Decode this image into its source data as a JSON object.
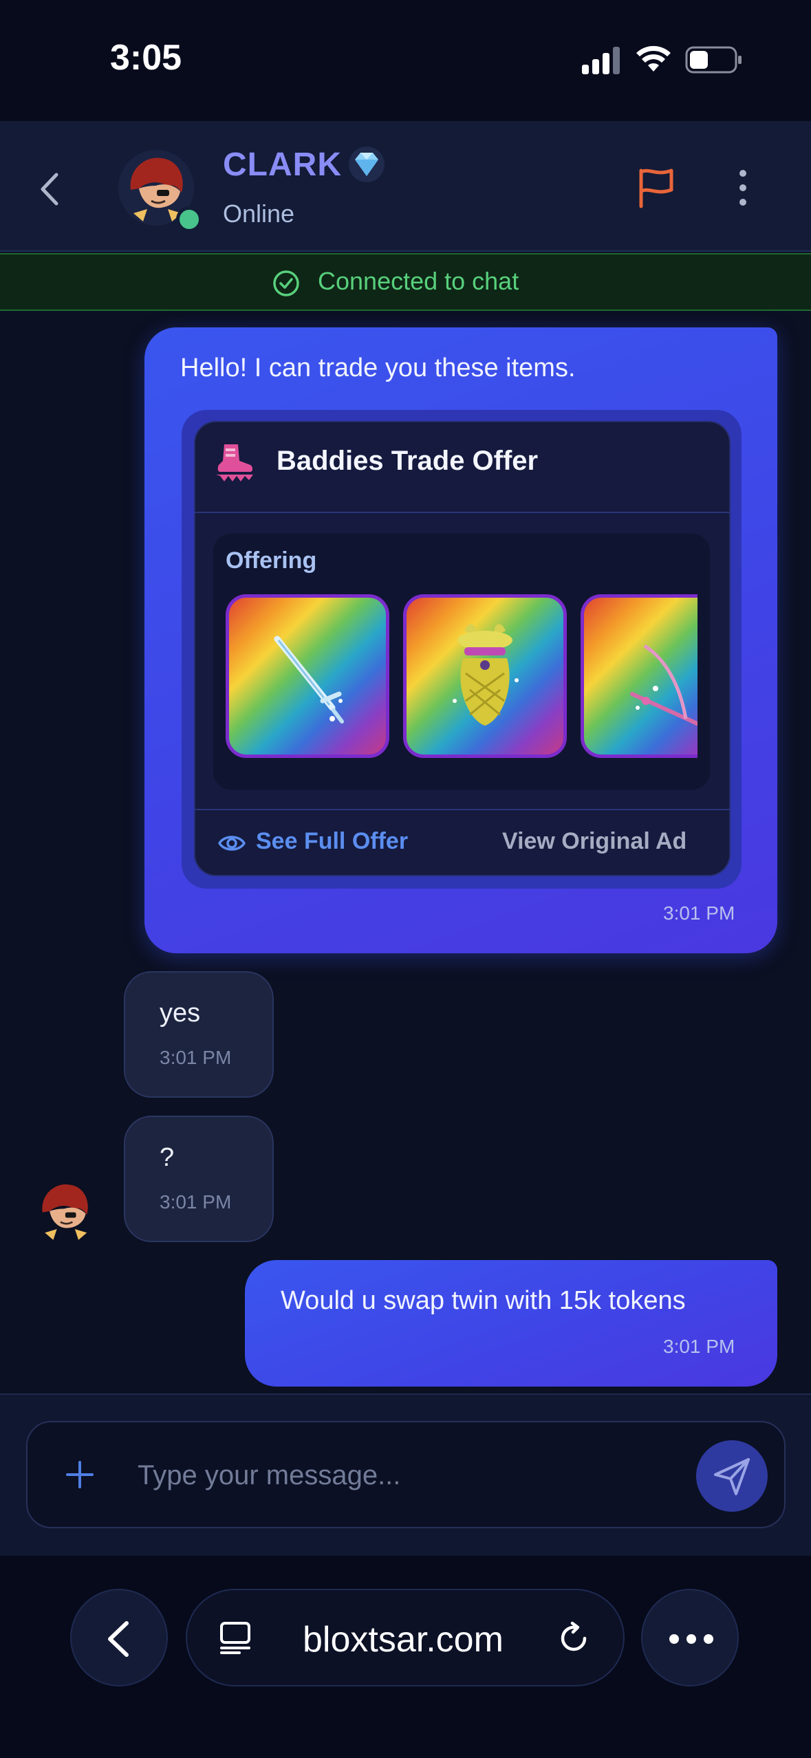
{
  "status_bar": {
    "time": "3:05"
  },
  "header": {
    "contact_name": "CLARK",
    "contact_status": "Online"
  },
  "banner": {
    "text": "Connected to chat"
  },
  "messages": [
    {
      "direction": "outgoing",
      "text": "Hello! I can trade you these items.",
      "time": "3:01 PM",
      "offer_card": {
        "title": "Baddies Trade Offer",
        "section_label": "Offering",
        "items": [
          "sword-item",
          "pineapple-item",
          "scythe-item"
        ],
        "see_full_label": "See Full Offer",
        "view_ad_label": "View Original Ad"
      }
    },
    {
      "direction": "incoming",
      "text": "yes",
      "time": "3:01 PM"
    },
    {
      "direction": "incoming",
      "text": "?",
      "time": "3:01 PM"
    },
    {
      "direction": "outgoing",
      "text": "Would u swap twin with 15k tokens",
      "time": "3:01 PM"
    }
  ],
  "composer": {
    "placeholder": "Type your message...",
    "value": ""
  },
  "browser": {
    "url": "bloxtsar.com"
  },
  "colors": {
    "accent": "#3f45e6",
    "name": "#8a8cf6",
    "online": "#48c38c",
    "connected": "#58d07c",
    "flag": "#e8653a",
    "link": "#5b8ef0"
  }
}
